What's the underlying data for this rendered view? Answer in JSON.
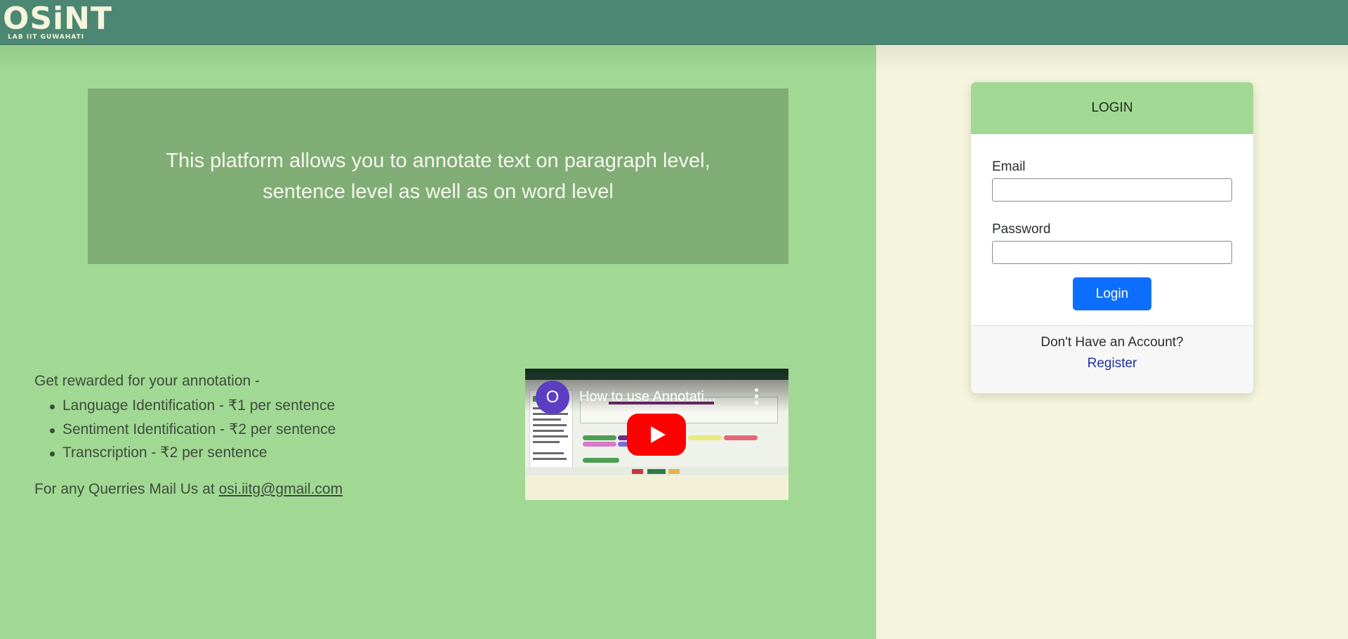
{
  "brand": {
    "name": "OSiNT",
    "subtitle": "LAB IIT GUWAHATI"
  },
  "hero": {
    "text": "This platform allows you to annotate text on paragraph level, sentence level as well as on word level"
  },
  "rewards": {
    "title": "Get rewarded for your annotation -",
    "items": [
      "Language Identification - ₹1 per sentence",
      "Sentiment Identification - ₹2 per sentence",
      "Transcription - ₹2 per sentence"
    ]
  },
  "contact": {
    "prefix": "For any Querries Mail Us at ",
    "email": "osi.iitg@gmail.com"
  },
  "video": {
    "title": "How to use Annotati...",
    "channel_initial": "O"
  },
  "login": {
    "header": "LOGIN",
    "email_label": "Email",
    "email_value": "",
    "password_label": "Password",
    "password_value": "",
    "button_label": "Login",
    "footer_text": "Don't Have an Account?",
    "register_label": "Register"
  },
  "colors": {
    "navbar": "#4b8773",
    "left_panel": "#a1d994",
    "right_panel": "#f5f4dc",
    "hero_box": "#80ad76",
    "login_header": "#a1d994",
    "login_button": "#0d6efd",
    "register_link": "#1f2fa0",
    "play_button": "#ff0000"
  }
}
